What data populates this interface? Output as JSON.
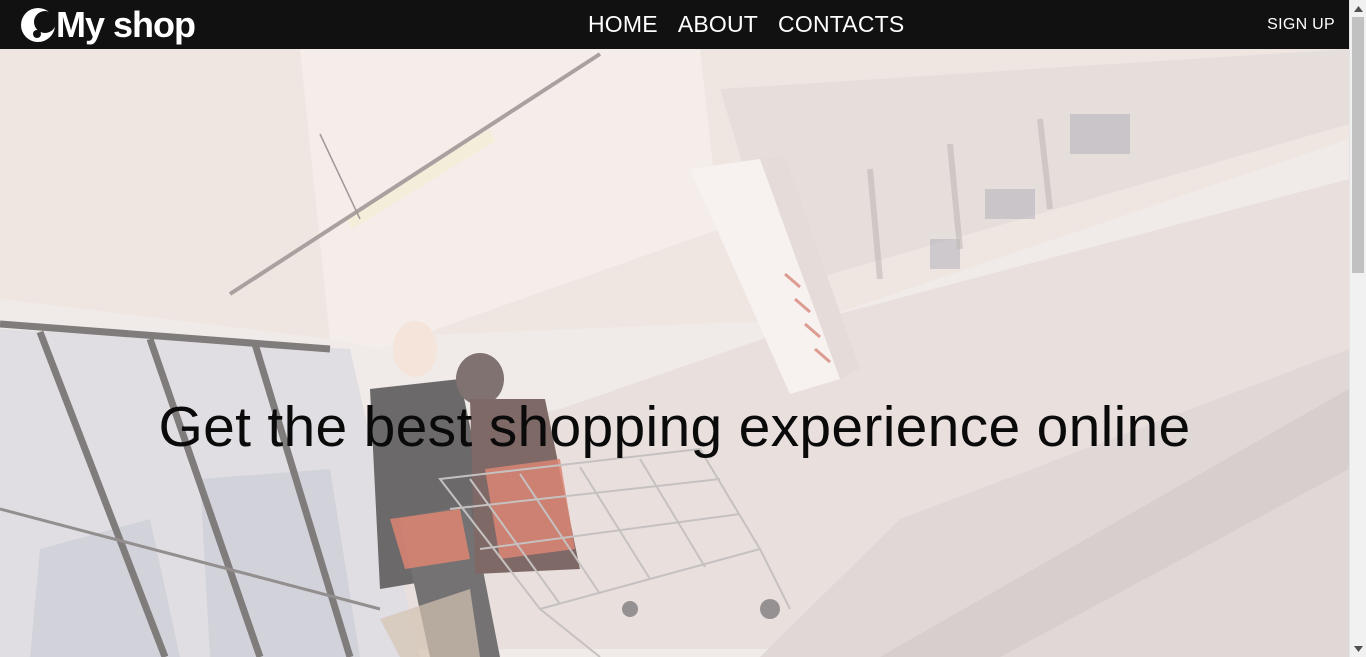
{
  "navbar": {
    "brand_logo_icon": "crescent-logo-icon",
    "brand_text": "My shop",
    "links": [
      {
        "label": "HOME"
      },
      {
        "label": "ABOUT"
      },
      {
        "label": "CONTACTS"
      }
    ],
    "signup_label": "SIGN UP",
    "background_color": "#111111",
    "text_color": "#ffffff"
  },
  "hero": {
    "heading": "Get the best shopping experience online",
    "image_subject": "hero-photo-icon",
    "overlay_color": "#fff8f6"
  },
  "scrollbar": {
    "up_icon": "scroll-up-arrow-icon",
    "down_icon": "scroll-down-arrow-icon"
  }
}
